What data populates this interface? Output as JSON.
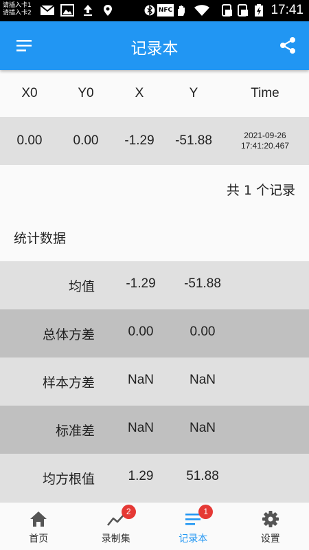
{
  "status_bar": {
    "sim1": "请插入卡1",
    "sim2": "请插入卡2",
    "nfc": "NFC",
    "time": "17:41"
  },
  "app_bar": {
    "title": "记录本",
    "menu_icon": "menu-icon",
    "share_icon": "share-icon"
  },
  "table": {
    "headers": [
      "X0",
      "Y0",
      "X",
      "Y",
      "Time"
    ],
    "rows": [
      {
        "x0": "0.00",
        "y0": "0.00",
        "x": "-1.29",
        "y": "-51.88",
        "date": "2021-09-26",
        "time": "17:41:20.467"
      }
    ]
  },
  "record_count": "共 1 个记录",
  "stats": {
    "title": "统计数据",
    "rows": [
      {
        "label": "均值",
        "v1": "-1.29",
        "v2": "-51.88"
      },
      {
        "label": "总体方差",
        "v1": "0.00",
        "v2": "0.00"
      },
      {
        "label": "样本方差",
        "v1": "NaN",
        "v2": "NaN"
      },
      {
        "label": "标准差",
        "v1": "NaN",
        "v2": "NaN"
      },
      {
        "label": "均方根值",
        "v1": "1.29",
        "v2": "51.88"
      }
    ]
  },
  "bottom_nav": {
    "items": [
      {
        "label": "首页",
        "icon": "home-icon",
        "badge": ""
      },
      {
        "label": "录制集",
        "icon": "trend-icon",
        "badge": "2"
      },
      {
        "label": "记录本",
        "icon": "list-icon",
        "badge": "1",
        "active": true
      },
      {
        "label": "设置",
        "icon": "gear-icon",
        "badge": ""
      }
    ]
  },
  "colors": {
    "primary": "#2196f3",
    "row_light": "#e0e0e0",
    "row_dark": "#c0c0c0",
    "badge": "#e53935"
  }
}
